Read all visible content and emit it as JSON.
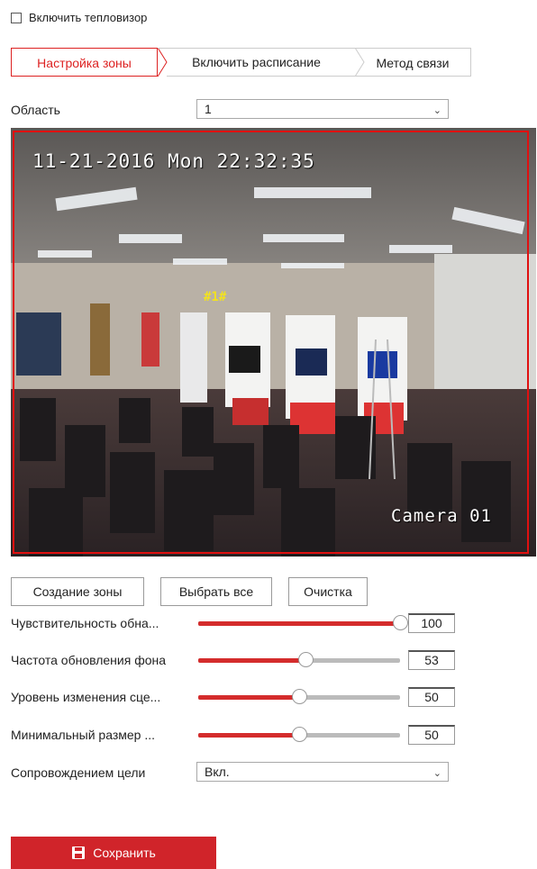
{
  "thermal": {
    "label": "Включить тепловизор",
    "checked": false
  },
  "tabs": [
    {
      "label": "Настройка зоны",
      "active": true
    },
    {
      "label": "Включить расписание",
      "active": false
    },
    {
      "label": "Метод связи",
      "active": false
    }
  ],
  "area": {
    "label": "Область",
    "value": "1"
  },
  "video": {
    "timestamp": "11-21-2016 Mon 22:32:35",
    "camera_name": "Camera 01",
    "zone_label": "#1#"
  },
  "buttons": {
    "create_zone": "Создание зоны",
    "select_all": "Выбрать все",
    "clear": "Очистка"
  },
  "sliders": [
    {
      "label": "Чувствительность обна...",
      "value": 100,
      "value_text": "100",
      "fraction": 1.0
    },
    {
      "label": "Частота обновления фона",
      "value": 53,
      "value_text": "53",
      "fraction": 0.53
    },
    {
      "label": "Уровень изменения сце...",
      "value": 50,
      "value_text": "50",
      "fraction": 0.5
    },
    {
      "label": "Минимальный размер ...",
      "value": 50,
      "value_text": "50",
      "fraction": 0.5
    }
  ],
  "tracking": {
    "label": "Сопровождением цели",
    "value": "Вкл."
  },
  "save": {
    "label": "Сохранить"
  },
  "colors": {
    "accent": "#d0242a",
    "zone_border": "#e01010",
    "slider_fill": "#d42c2c"
  },
  "icons": {
    "dropdown": "chevron-down-icon",
    "save": "floppy-disk-icon"
  }
}
